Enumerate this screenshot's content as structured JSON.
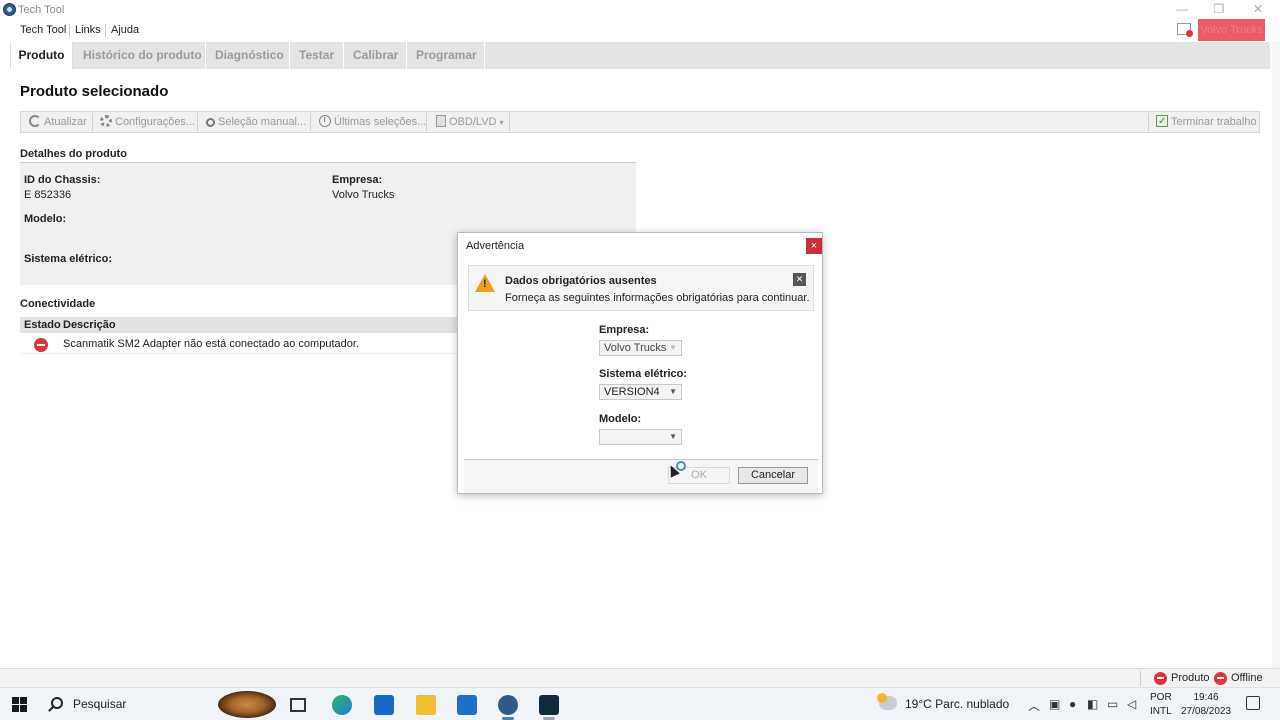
{
  "window": {
    "title": "Tech Tool",
    "controls": {
      "minimize": "—",
      "restore": "❐",
      "close": "✕"
    }
  },
  "menu": {
    "items": [
      "Tech Tool",
      "Links",
      "Ajuda"
    ],
    "user_button": "Volvo Trucks"
  },
  "tabs": [
    "Produto",
    "Histórico do produto",
    "Diagnóstico",
    "Testar",
    "Calibrar",
    "Programar"
  ],
  "page": {
    "title": "Produto selecionado"
  },
  "toolbar": {
    "refresh": "Atualizar",
    "settings": "Configurações...",
    "manual": "Seleção manual...",
    "recent": "Últimas seleções...",
    "obd": "OBD/LVD",
    "finish": "Terminar trabalho"
  },
  "details": {
    "section_title": "Detalhes do produto",
    "chassis_label": "ID do Chassis:",
    "chassis_value": "E 852336",
    "company_label": "Empresa:",
    "company_value": "Volvo Trucks",
    "model_label": "Modelo:",
    "electrical_label": "Sistema elétrico:"
  },
  "connectivity": {
    "section_title": "Conectividade",
    "col_status": "Estado",
    "col_description": "Descrição",
    "rows": [
      {
        "status": "error",
        "description": "Scanmatik SM2 Adapter não está conectado ao computador."
      }
    ]
  },
  "dialog": {
    "title": "Advertência",
    "close": "×",
    "warning_title": "Dados obrigatórios ausentes",
    "warning_text": "Forneça as seguintes informações obrigatórias para continuar.",
    "warning_close": "✕",
    "company_label": "Empresa:",
    "company_value": "Volvo Trucks",
    "electrical_label": "Sistema elétrico:",
    "electrical_value": "VERSION4",
    "model_label": "Modelo:",
    "model_value": "",
    "ok": "OK",
    "cancel": "Cancelar"
  },
  "statusbar": {
    "product": "Produto",
    "offline": "Offline"
  },
  "taskbar": {
    "search": "Pesquisar",
    "weather": "19°C  Parc. nublado",
    "lang_top": "POR",
    "lang_bottom": "INTL",
    "time": "19:46",
    "date": "27/08/2023"
  },
  "colors": {
    "user_button": "#ec5a64",
    "error": "#d9363e",
    "warning": "#e8a317",
    "dialog_close": "#c8303a"
  }
}
